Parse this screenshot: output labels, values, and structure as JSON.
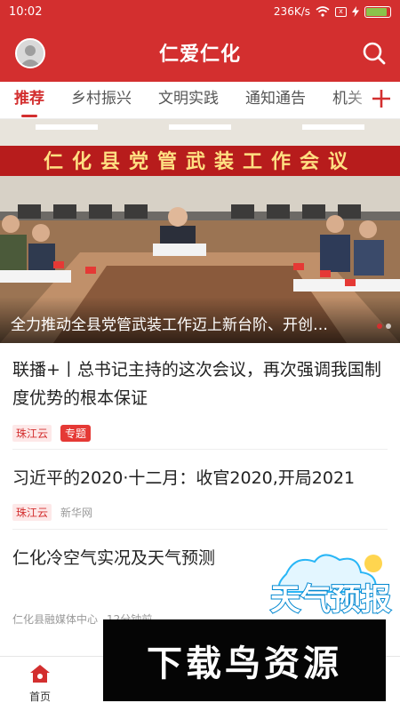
{
  "status_bar": {
    "time": "10:02",
    "net_speed": "236K/s",
    "sim_label": "x",
    "battery_level": 0.9,
    "battery_color": "#8bc34a"
  },
  "header": {
    "title": "仁爱仁化",
    "avatar_icon": "user-avatar-icon",
    "search_icon": "search-icon",
    "bg_color": "#d32f2f"
  },
  "tabs": [
    {
      "label": "推荐",
      "active": true
    },
    {
      "label": "乡村振兴",
      "active": false
    },
    {
      "label": "文明实践",
      "active": false
    },
    {
      "label": "通知通告",
      "active": false
    },
    {
      "label": "机关",
      "active": false
    }
  ],
  "tabs_add_icon": "plus-icon",
  "banner": {
    "wall_banner_text": "仁化县党管武装工作会议",
    "caption": "全力推动全县党管武装工作迈上新台阶、开创…",
    "dot_count": 2,
    "active_dot": 0
  },
  "news": [
    {
      "title": "联播+丨总书记主持的这次会议，再次强调我国制度优势的根本保证",
      "source_tag": "珠江云",
      "topic_tag": "专题"
    },
    {
      "title": "习近平的2020·十二月：收官2020,开局2021",
      "source_tag": "珠江云",
      "publisher": "新华网"
    },
    {
      "title": "仁化冷空气实况及天气预测",
      "publisher": "仁化县融媒体中心",
      "time": "12分钟前",
      "sticker_text": "天气预报"
    }
  ],
  "bottom_nav": {
    "home_label": "首页",
    "home_icon": "home-icon"
  },
  "watermark": {
    "text": "下载鸟资源"
  }
}
